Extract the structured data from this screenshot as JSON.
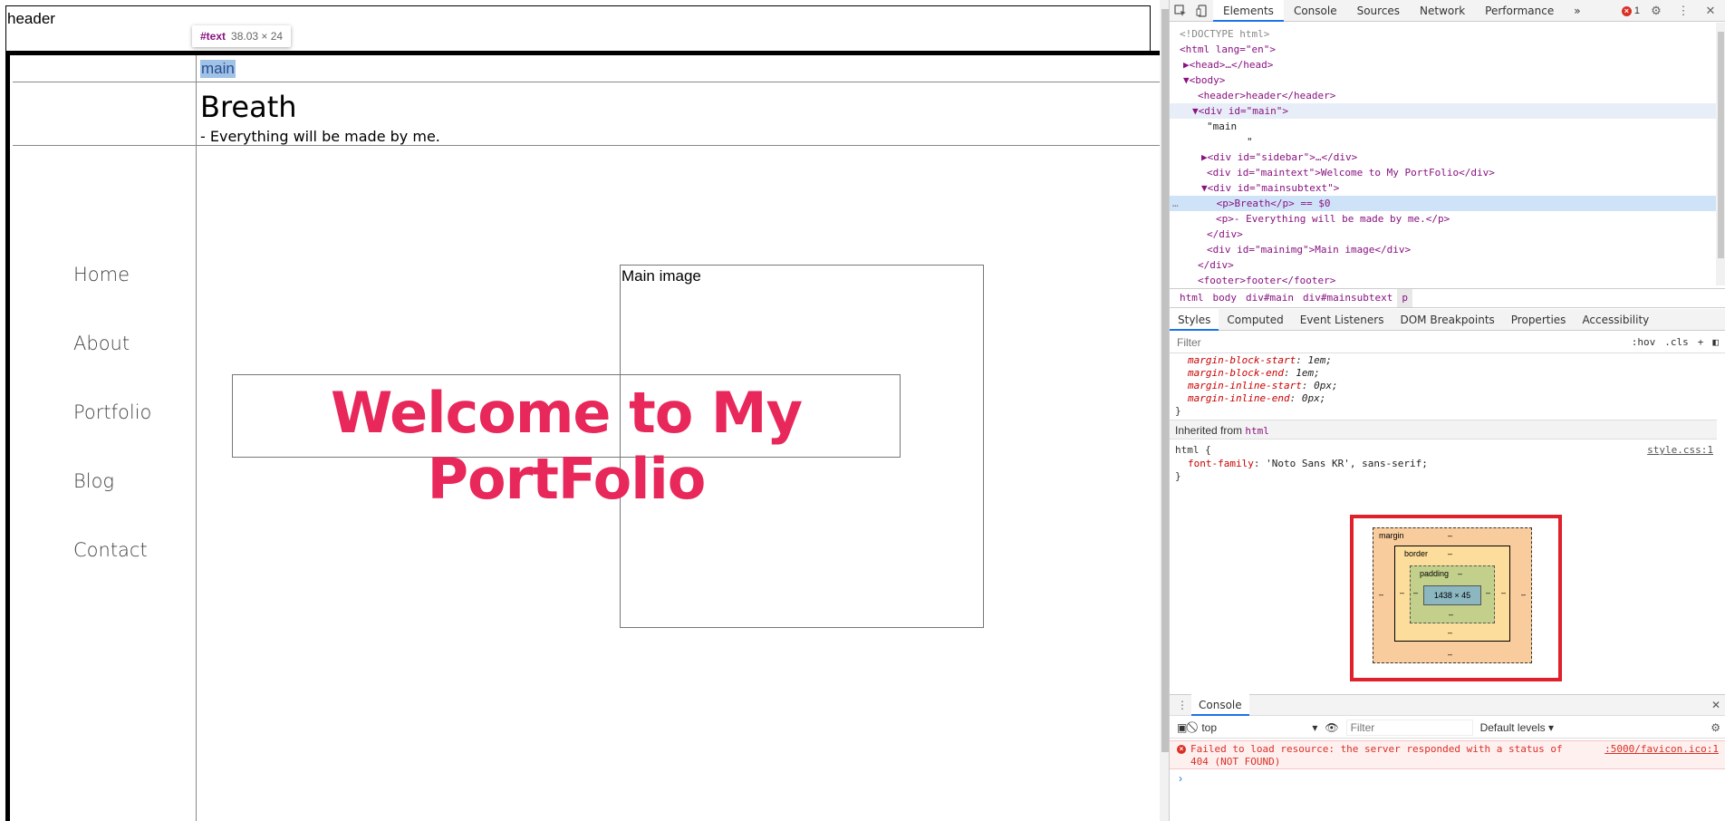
{
  "page": {
    "header": "header",
    "main_text": "main",
    "breath": "Breath",
    "breath_sub": "- Everything will be made by me.",
    "nav": [
      "Home",
      "About",
      "Portfolio",
      "Blog",
      "Contact"
    ],
    "main_image": "Main image",
    "welcome": "Welcome to My PortFolio",
    "tooltip": {
      "tag": "#text",
      "dims": "38.03 × 24"
    }
  },
  "devtools": {
    "tabs": [
      "Elements",
      "Console",
      "Sources",
      "Network",
      "Performance"
    ],
    "more": "»",
    "error_count": "1",
    "dom": [
      "<!DOCTYPE html>",
      "<html lang=\"en\">",
      "▶<head>…</head>",
      "▼<body>",
      "<header>header</header>",
      "▼<div id=\"main\">",
      "\"main",
      "\"",
      "▶<div id=\"sidebar\">…</div>",
      "<div id=\"maintext\">Welcome to My PortFolio</div>",
      "▼<div id=\"mainsubtext\">",
      "<p>Breath</p> == $0",
      "<p>- Everything will be made by me.</p>",
      "</div>",
      "<div id=\"mainimg\">Main image</div>",
      "</div>",
      "<footer>footer</footer>"
    ],
    "dom_ellipsis": "…",
    "breadcrumb": [
      "html",
      "body",
      "div#main",
      "div#mainsubtext",
      "p"
    ],
    "style_tabs": [
      "Styles",
      "Computed",
      "Event Listeners",
      "DOM Breakpoints",
      "Properties",
      "Accessibility"
    ],
    "filter_placeholder": "Filter",
    "filter_hov": ":hov",
    "filter_cls": ".cls",
    "filter_plus": "+",
    "ua_props": [
      {
        "name": "margin-block-start",
        "value": "1em;"
      },
      {
        "name": "margin-block-end",
        "value": "1em;"
      },
      {
        "name": "margin-inline-start",
        "value": "0px;"
      },
      {
        "name": "margin-inline-end",
        "value": "0px;"
      }
    ],
    "close_brace": "}",
    "inherited_label": "Inherited from",
    "inherited_tag": "html",
    "html_rule": {
      "selector": "html {",
      "source": "style.css:1",
      "prop": "font-family",
      "value": "'Noto Sans KR', sans-serif;"
    },
    "boxmodel": {
      "margin": "margin",
      "border": "border",
      "padding": "padding",
      "content": "1438 × 45",
      "dash": "–"
    },
    "console": {
      "tab": "Console",
      "context": "top",
      "filter_placeholder": "Filter",
      "levels": "Default levels ▾",
      "error_msg": "Failed to load resource: the server responded with a status of 404 (NOT FOUND)",
      "error_src": ":5000/favicon.ico:1",
      "prompt": "›"
    }
  }
}
